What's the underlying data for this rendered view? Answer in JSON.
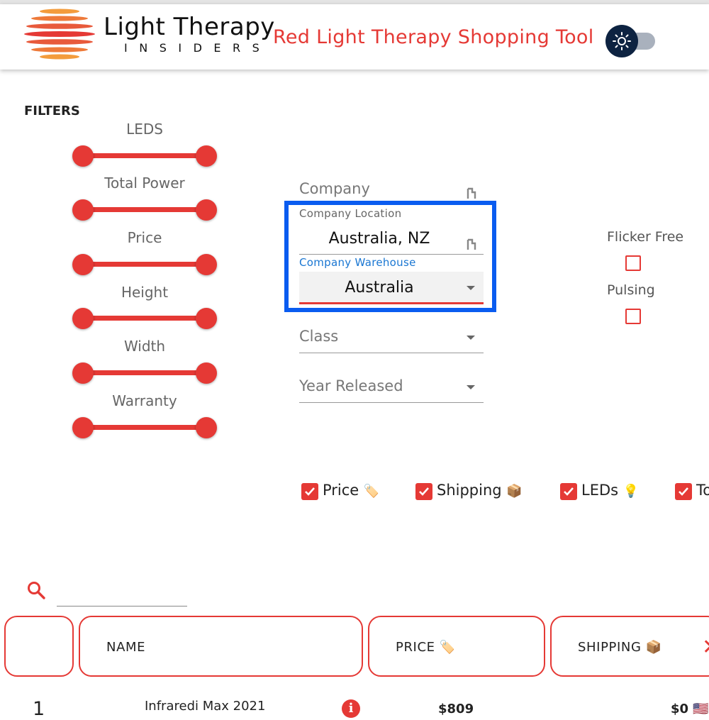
{
  "header": {
    "brand_line1": "Light Therapy",
    "brand_line2": "INSIDERS",
    "app_title": "Red Light Therapy Shopping Tool",
    "theme_toggle_icon": "sun-icon"
  },
  "filters": {
    "title": "FILTERS",
    "sliders": [
      {
        "label": "LEDS"
      },
      {
        "label": "Total Power"
      },
      {
        "label": "Price"
      },
      {
        "label": "Height"
      },
      {
        "label": "Width"
      },
      {
        "label": "Warranty"
      }
    ],
    "company": {
      "placeholder": "Company"
    },
    "company_location": {
      "label": "Company Location",
      "value": "Australia, NZ"
    },
    "company_warehouse": {
      "label": "Company Warehouse",
      "value": "Australia"
    },
    "class": {
      "placeholder": "Class"
    },
    "year_released": {
      "placeholder": "Year Released"
    },
    "flicker_free": {
      "label": "Flicker Free",
      "checked": false
    },
    "pulsing": {
      "label": "Pulsing",
      "checked": false
    }
  },
  "columns": {
    "toggles": [
      {
        "label": "Price",
        "emoji": "🏷️",
        "checked": true
      },
      {
        "label": "Shipping",
        "emoji": "📦",
        "checked": true
      },
      {
        "label": "LEDs",
        "emoji": "💡",
        "checked": true
      },
      {
        "label": "To",
        "emoji": "",
        "checked": true
      }
    ]
  },
  "table": {
    "headers": [
      "",
      "NAME",
      "PRICE 🏷️",
      "SHIPPING 📦"
    ],
    "rows": [
      {
        "rank": "1",
        "name": "Infraredi Max 2021",
        "price": "$809",
        "shipping": "$0 🇺🇸"
      }
    ]
  },
  "colors": {
    "accent": "#e53935",
    "highlight": "#0a5cf0",
    "toggle_knob": "#0d2341"
  }
}
